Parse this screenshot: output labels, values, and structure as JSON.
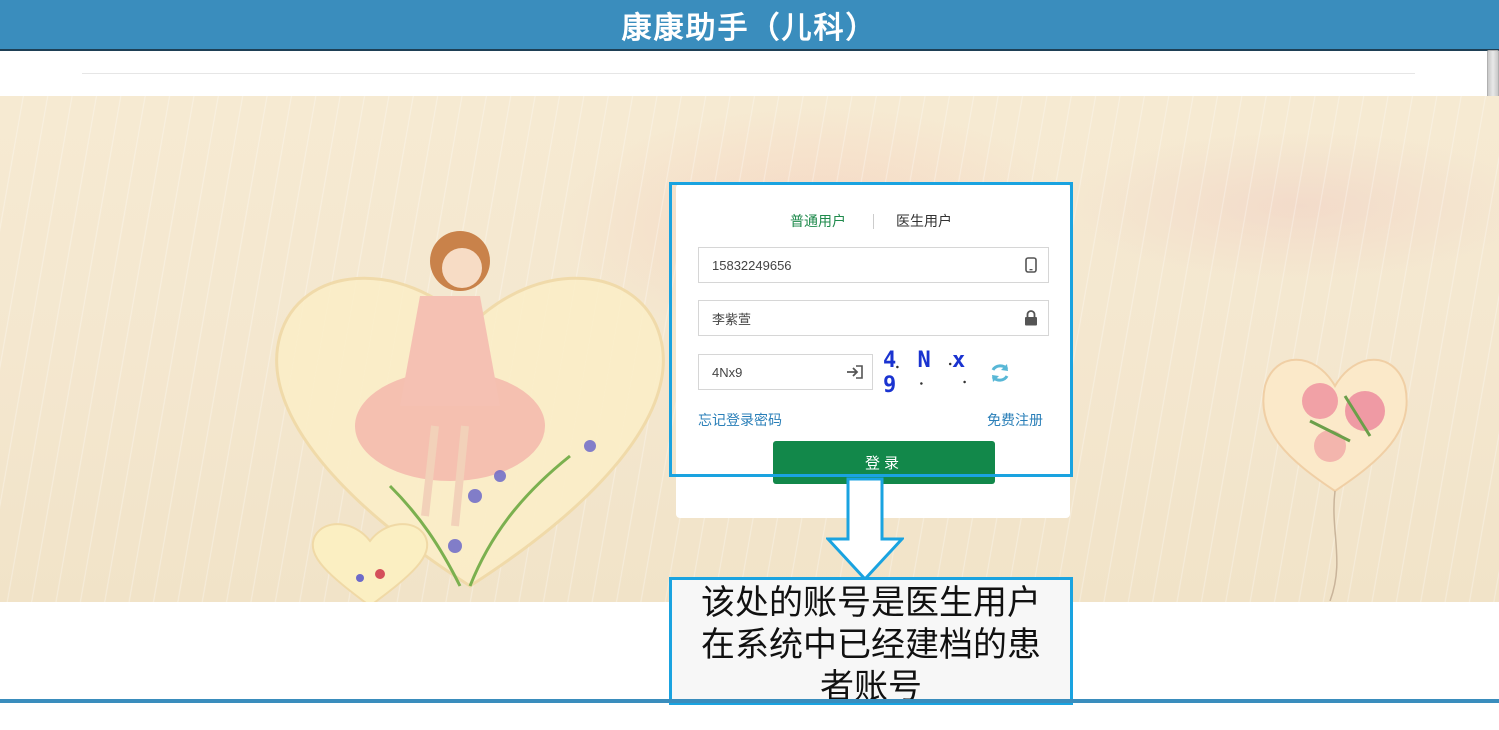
{
  "header": {
    "title": "康康助手（儿科）"
  },
  "login": {
    "tabs": [
      {
        "label": "普通用户",
        "active": true
      },
      {
        "label": "医生用户",
        "active": false
      }
    ],
    "phone_value": "15832249656",
    "password_value": "李紫萱",
    "captcha_input_value": "4Nx9",
    "captcha_text": "4 N x 9",
    "forgot_link": "忘记登录密码",
    "register_link": "免费注册",
    "login_button": "登录"
  },
  "annotation": {
    "note_text": "该处的账号是医生用户在系统中已经建档的患者账号"
  },
  "colors": {
    "header_bg": "#3a8dbd",
    "accent_green": "#12884a",
    "highlight_blue": "#1aa3e0",
    "link_blue": "#2a7fb8"
  },
  "icons": [
    "phone-icon",
    "lock-icon",
    "login-enter-icon",
    "refresh-icon",
    "arrow-down-icon"
  ]
}
